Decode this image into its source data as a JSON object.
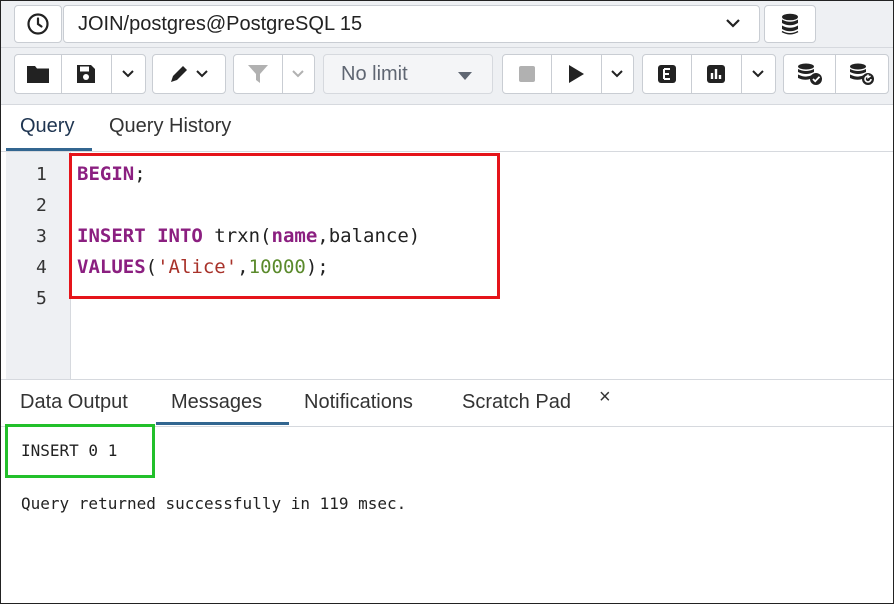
{
  "connection": {
    "label": "JOIN/postgres@PostgreSQL 15"
  },
  "toolbar": {
    "limit_label": "No limit"
  },
  "editor_tabs": [
    "Query",
    "Query History"
  ],
  "editor": {
    "line_numbers": [
      "1",
      "2",
      "3",
      "4",
      "5"
    ],
    "code": {
      "l1_kw": "BEGIN",
      "l1_rest": ";",
      "l3_kw1": "INSERT",
      "l3_kw2": "INTO",
      "l3_tbl": " trxn(",
      "l3_col": "name",
      "l3_rest": ",balance)",
      "l4_kw": "VALUES",
      "l4_open": "(",
      "l4_str": "'Alice'",
      "l4_comma": ",",
      "l4_num": "10000",
      "l4_close": ");"
    }
  },
  "output_tabs": [
    "Data Output",
    "Messages",
    "Notifications",
    "Scratch Pad"
  ],
  "output_close": "×",
  "messages": {
    "result": "INSERT 0 1",
    "status": "Query returned successfully in 119 msec."
  },
  "colors": {
    "highlight_red": "#e5141a",
    "highlight_green": "#22c02a",
    "active_tab": "#326690",
    "keyword": "#8b1f80"
  }
}
